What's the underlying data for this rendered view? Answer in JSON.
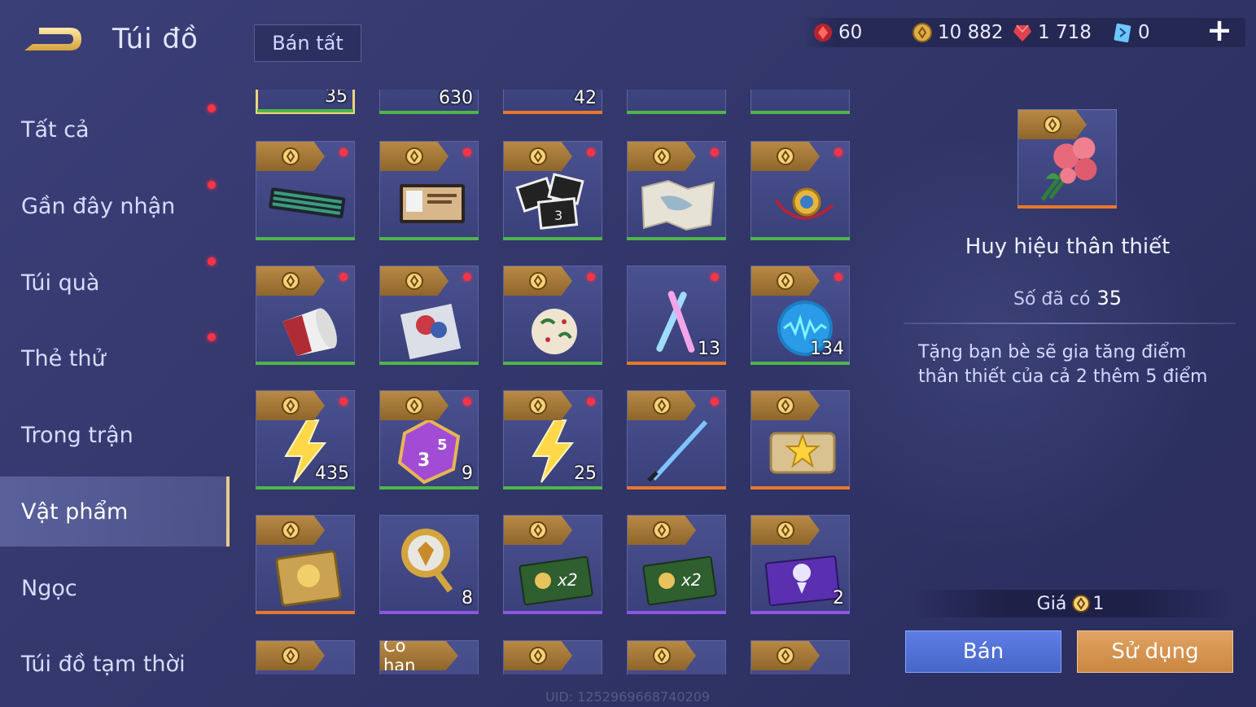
{
  "header": {
    "title": "Túi đồ",
    "sell_all": "Bán tất",
    "currencies": [
      {
        "icon": "red-gem-icon",
        "value": "60"
      },
      {
        "icon": "gold-coin-icon",
        "value": "10 882"
      },
      {
        "icon": "ruby-icon",
        "value": "1 718"
      },
      {
        "icon": "ticket-icon",
        "value": "0"
      }
    ],
    "plus": "+"
  },
  "sidebar": {
    "items": [
      {
        "label": "Tất cả",
        "dot": true
      },
      {
        "label": "Gần đây nhận",
        "dot": true
      },
      {
        "label": "Túi quà",
        "dot": true
      },
      {
        "label": "Thẻ thử",
        "dot": true
      },
      {
        "label": "Trong trận",
        "dot": false
      },
      {
        "label": "Vật phẩm",
        "dot": false,
        "active": true
      },
      {
        "label": "Ngọc",
        "dot": false
      },
      {
        "label": "Túi đồ tạm thời",
        "dot": false
      }
    ]
  },
  "grid": {
    "top_row_counts": [
      "35",
      "630",
      "42",
      "",
      ""
    ],
    "rows": [
      [
        {
          "icon": "keyboard-icon",
          "count": "",
          "dot": true,
          "bar": "green"
        },
        {
          "icon": "id-card-icon",
          "count": "",
          "dot": true,
          "bar": "green"
        },
        {
          "icon": "photo-cards-icon",
          "count": "",
          "dot": true,
          "bar": "green"
        },
        {
          "icon": "map-icon",
          "count": "",
          "dot": true,
          "bar": "green"
        },
        {
          "icon": "medal-icon",
          "count": "",
          "dot": true,
          "bar": "green"
        }
      ],
      [
        {
          "icon": "cup-icon",
          "count": "",
          "dot": true,
          "bar": "green"
        },
        {
          "icon": "sticker-icon",
          "count": "",
          "dot": true,
          "bar": "green"
        },
        {
          "icon": "ornament-ball-icon",
          "count": "",
          "dot": true,
          "bar": "green"
        },
        {
          "icon": "glowsticks-icon",
          "count": "13",
          "dot": true,
          "bar": "orange"
        },
        {
          "icon": "voice-orb-icon",
          "count": "134",
          "dot": true,
          "bar": "green"
        }
      ],
      [
        {
          "icon": "lightning-icon",
          "count": "435",
          "dot": true,
          "bar": "green"
        },
        {
          "icon": "dice-icon",
          "count": "9",
          "dot": true,
          "bar": "green"
        },
        {
          "icon": "lightning-icon",
          "count": "25",
          "dot": true,
          "bar": "green"
        },
        {
          "icon": "sword-icon",
          "count": "",
          "dot": true,
          "bar": "orange"
        },
        {
          "icon": "star-ticket-icon",
          "count": "",
          "dot": false,
          "bar": "orange"
        }
      ],
      [
        {
          "icon": "gold-card-icon",
          "count": "",
          "dot": false,
          "bar": "orange"
        },
        {
          "icon": "shield-trophy-icon",
          "count": "8",
          "dot": false,
          "bar": "purple",
          "no_tag": true
        },
        {
          "icon": "x2-card-icon",
          "count": "",
          "dot": false,
          "bar": "purple",
          "label": "x2"
        },
        {
          "icon": "x2-card-icon",
          "count": "",
          "dot": false,
          "bar": "purple",
          "label": "x2"
        },
        {
          "icon": "rose-card-icon",
          "count": "2",
          "dot": false,
          "bar": "purple"
        }
      ]
    ],
    "bottom_tag_text": "Có hạn"
  },
  "detail": {
    "name": "Huy hiệu thân thiết",
    "owned_label": "Số đã có",
    "owned_value": "35",
    "description": "Tặng bạn bè sẽ gia tăng điểm thân thiết của cả 2 thêm 5 điểm",
    "price_label": "Giá",
    "price_value": "1",
    "sell_label": "Bán",
    "use_label": "Sử dụng"
  },
  "uid": "UID: 1252969668740209",
  "colors": {
    "accent_gold": "#e9c98b",
    "rarity_green": "#4fb54a",
    "rarity_orange": "#e9772a",
    "rarity_purple": "#8d57e0"
  }
}
